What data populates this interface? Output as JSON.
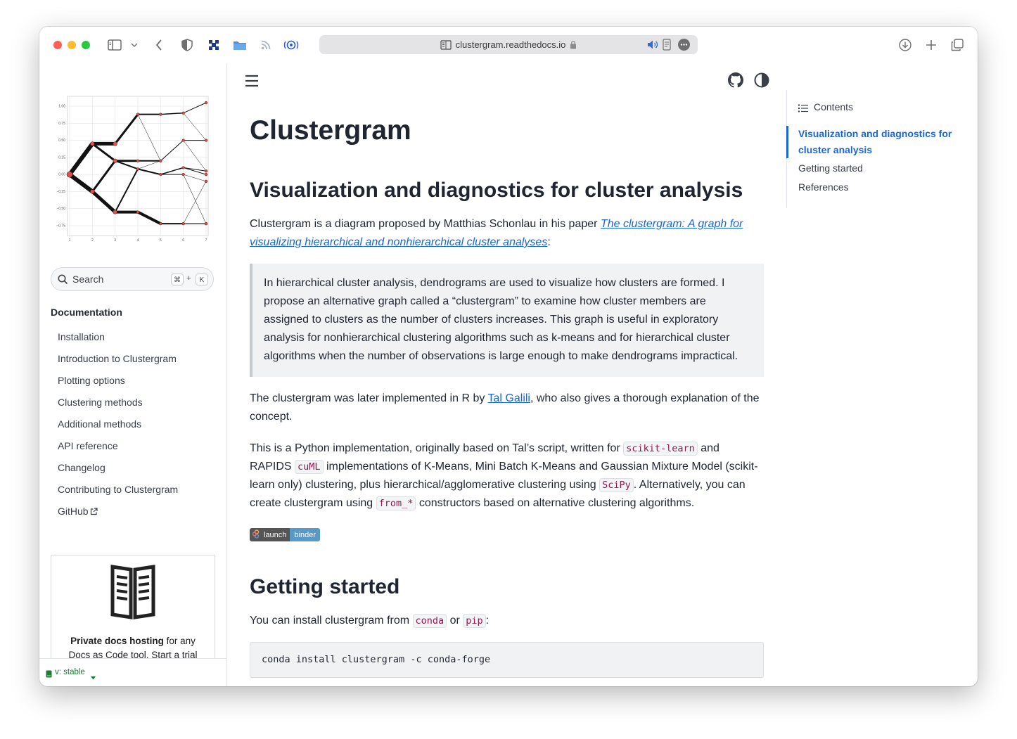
{
  "browser": {
    "url": "clustergram.readthedocs.io"
  },
  "sidebar": {
    "logo_axis": {
      "y_ticks": [
        "1.00",
        "0.75",
        "0.50",
        "0.25",
        "0.00",
        "−0.25",
        "−0.50",
        "−0.75"
      ],
      "x_ticks": [
        "1",
        "2",
        "3",
        "4",
        "5",
        "6",
        "7"
      ]
    },
    "search": {
      "placeholder": "Search",
      "shortcut_mod": "⌘",
      "shortcut_plus": "+",
      "shortcut_key": "K"
    },
    "section_title": "Documentation",
    "nav_items": [
      {
        "label": "Installation"
      },
      {
        "label": "Introduction to Clustergram"
      },
      {
        "label": "Plotting options"
      },
      {
        "label": "Clustering methods"
      },
      {
        "label": "Additional methods"
      },
      {
        "label": "API reference"
      },
      {
        "label": "Changelog"
      },
      {
        "label": "Contributing to Clustergram"
      },
      {
        "label": "GitHub"
      }
    ],
    "ad": {
      "bold_text": "Private docs hosting",
      "text_1": " for any",
      "text_2": "Docs as Code tool. Start a trial"
    },
    "version": "v: stable"
  },
  "main": {
    "title": "Clustergram",
    "section1": {
      "heading": "Visualization and diagnostics for cluster analysis",
      "intro_before": "Clustergram is a diagram proposed by Matthias Schonlau in his paper ",
      "intro_link": "The clustergram: A graph for visualizing hierarchical and nonhierarchical cluster analyses",
      "intro_after": ":",
      "quote": "In hierarchical cluster analysis, dendrograms are used to visualize how clusters are formed. I propose an alternative graph called a “clustergram” to examine how cluster members are assigned to clusters as the number of clusters increases. This graph is useful in exploratory analysis for nonhierarchical clustering algorithms such as k-means and for hierarchical cluster algorithms when the number of observations is large enough to make dendrograms impractical.",
      "p2_before": "The clustergram was later implemented in R by ",
      "p2_link": "Tal Galili",
      "p2_after": ", who also gives a thorough explanation of the concept.",
      "p3_a": "This is a Python implementation, originally based on Tal’s script, written for ",
      "p3_code1": "scikit-learn",
      "p3_b": " and RAPIDS ",
      "p3_code2": "cuML",
      "p3_c": " implementations of K-Means, Mini Batch K-Means and Gaussian Mixture Model (scikit-learn only) clustering, plus hierarchical/agglomerative clustering using ",
      "p3_code3": "SciPy",
      "p3_d": ". Alternatively, you can create clustergram using ",
      "p3_code4": "from_*",
      "p3_e": " constructors based on alternative clustering algorithms.",
      "badge_left": "launch",
      "badge_right": "binder"
    },
    "section2": {
      "heading": "Getting started",
      "p_before": "You can install clustergram from ",
      "code1": "conda",
      "p_mid": " or ",
      "code2": "pip",
      "p_after": ":",
      "codeblock": "conda install clustergram -c conda-forge"
    }
  },
  "toc": {
    "title": "Contents",
    "items": [
      {
        "label": "Visualization and diagnostics for cluster analysis",
        "active": true
      },
      {
        "label": "Getting started",
        "active": false
      },
      {
        "label": "References",
        "active": false
      }
    ]
  },
  "colors": {
    "accent": "#1a66d2",
    "close": "#fe5f57",
    "minimize": "#febc2e",
    "maximize": "#28c840",
    "code_text": "#8c1b52",
    "binder_dark": "#555555",
    "binder_blue": "#579aca",
    "version_green": "#1e7b34"
  }
}
